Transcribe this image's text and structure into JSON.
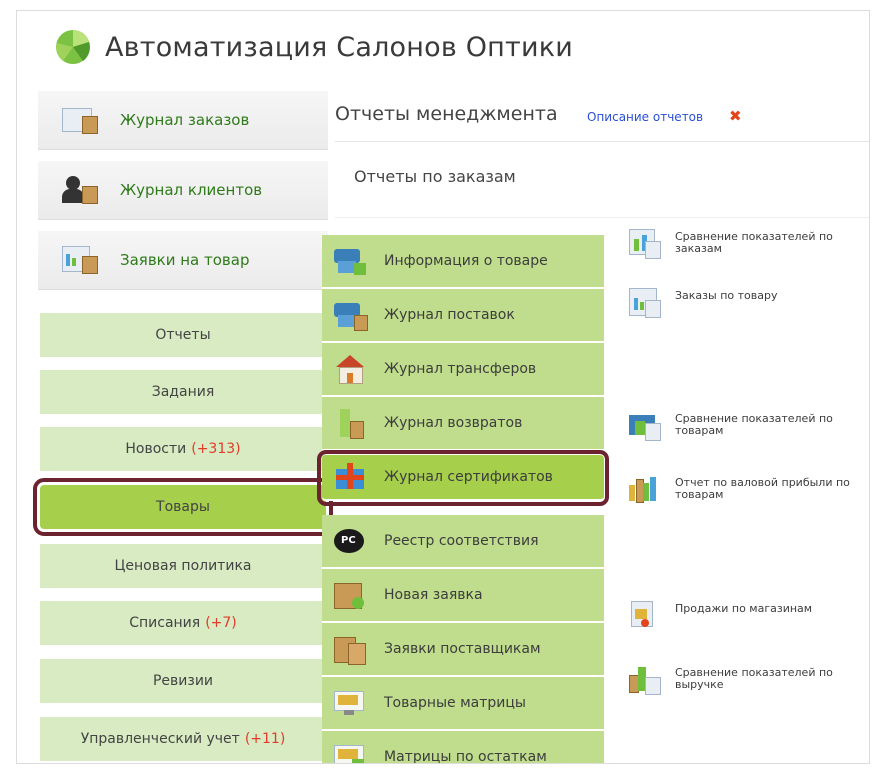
{
  "app": {
    "title": "Автоматизация Салонов Оптики"
  },
  "sidebar": {
    "top_items": [
      {
        "label": "Журнал заказов",
        "icon": "order-log-icon"
      },
      {
        "label": "Журнал клиентов",
        "icon": "client-icon"
      },
      {
        "label": "Заявки на товар",
        "icon": "product-request-icon"
      }
    ],
    "items": [
      {
        "label": "Отчеты",
        "count": ""
      },
      {
        "label": "Задания",
        "count": ""
      },
      {
        "label": "Новости",
        "count": "(+313)"
      },
      {
        "label": "Товары",
        "count": "",
        "active": true
      },
      {
        "label": "Ценовая политика",
        "count": ""
      },
      {
        "label": "Списания",
        "count": "(+7)"
      },
      {
        "label": "Ревизии",
        "count": ""
      },
      {
        "label": "Управленческий учет",
        "count": "(+11)"
      }
    ]
  },
  "main": {
    "heading": "Отчеты менеджмента",
    "description_link": "Описание отчетов",
    "close_glyph": "✖",
    "subheading": "Отчеты по заказам"
  },
  "dropdown": {
    "items": [
      {
        "label": "Информация о товаре",
        "icon": "product-info-icon"
      },
      {
        "label": "Журнал поставок",
        "icon": "delivery-log-icon"
      },
      {
        "label": "Журнал трансферов",
        "icon": "house-icon"
      },
      {
        "label": "Журнал возвратов",
        "icon": "return-log-icon"
      },
      {
        "label": "Журнал сертификатов",
        "icon": "gift-icon",
        "active": true
      },
      {
        "label": "Реестр соответствия",
        "icon": "pct-certification-icon"
      },
      {
        "label": "Новая заявка",
        "icon": "new-request-icon"
      },
      {
        "label": "Заявки поставщикам",
        "icon": "supplier-request-icon"
      },
      {
        "label": "Товарные матрицы",
        "icon": "matrix-icon"
      },
      {
        "label": "Матрицы по остаткам",
        "icon": "stock-matrix-icon"
      }
    ]
  },
  "reports": [
    {
      "label": "Сравнение показателей по заказам",
      "icon": "compare-chart-icon"
    },
    {
      "label": "Заказы по товару",
      "icon": "orders-chart-icon"
    },
    {
      "label": "Сравнение показателей по товарам",
      "icon": "compare-products-icon"
    },
    {
      "label": "Отчет по валовой прибыли по товарам",
      "icon": "bar-chart-icon"
    },
    {
      "label": "Продажи по магазинам",
      "icon": "store-sales-icon"
    },
    {
      "label": "Сравнение показателей по выручке",
      "icon": "revenue-chart-icon"
    }
  ],
  "colors": {
    "accent_green": "#a6cf4c",
    "menu_green": "#bfdd8c",
    "highlight_border": "#6b2330",
    "count_red": "#e23b2a",
    "link_blue": "#2a4fd6"
  }
}
